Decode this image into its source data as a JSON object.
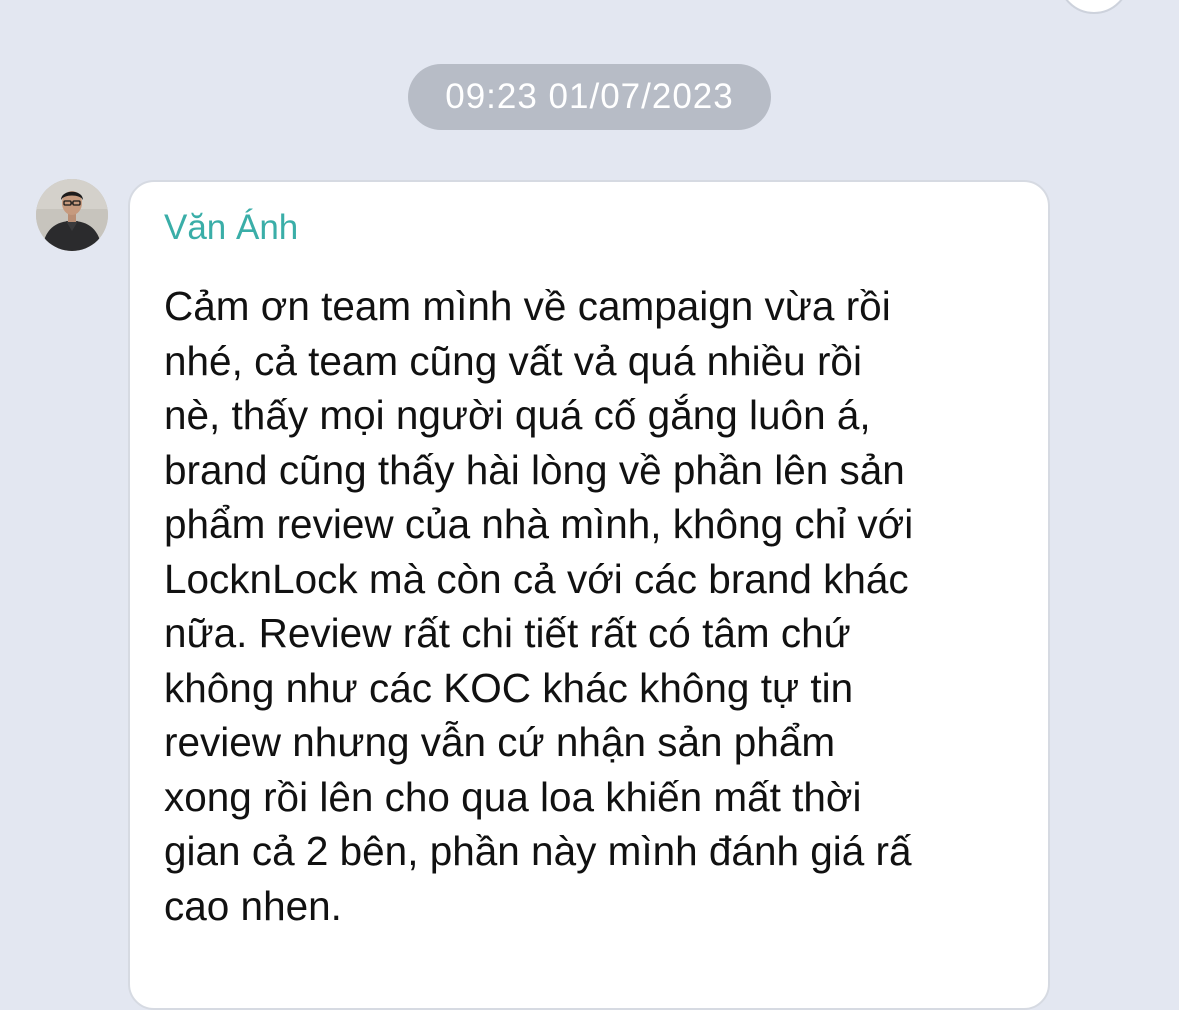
{
  "conversation": {
    "timestamp": "09:23 01/07/2023"
  },
  "message": {
    "sender_name": "Văn Ánh",
    "avatar_icon": "person-avatar-photo",
    "lines": [
      "Cảm ơn team mình về campaign vừa rồi",
      "nhé, cả team cũng vất vả quá nhiều rồi",
      "nè, thấy mọi người quá cố gắng luôn á,",
      "brand cũng thấy hài lòng về phần lên sản",
      "phẩm review của nhà mình, không chỉ với",
      "LocknLock mà còn cả với các brand khác",
      "nữa. Review rất chi tiết rất có tâm chứ",
      "không như các KOC khác không tự tin",
      "review nhưng vẫn cứ nhận sản phẩm",
      "xong rồi lên cho qua loa khiến mất thời",
      "gian cả 2 bên, phần này mình đánh giá rấ",
      "cao nhen."
    ]
  },
  "colors": {
    "background": "#e3e7f1",
    "sender_name": "#3aaea8",
    "timestamp_pill": "#b7bcc6",
    "bubble": "#ffffff"
  }
}
